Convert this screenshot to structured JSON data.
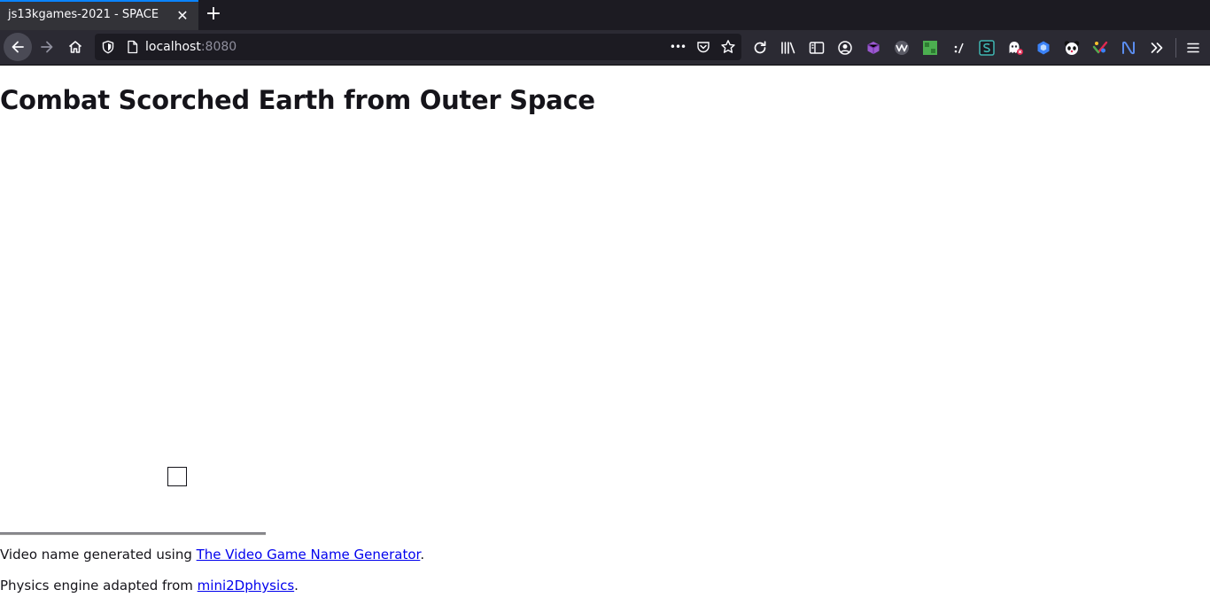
{
  "browser": {
    "tab_title": "js13kgames-2021 - SPACE",
    "tab_close_glyph": "✕",
    "new_tab_glyph": "+",
    "url_host": "localhost",
    "url_port": ":8080",
    "url_more_glyph": "•••",
    "toolbar_icons": [
      "reload-icon",
      "library-icon",
      "sidebar-icon",
      "account-icon",
      "extension-cube-icon",
      "extension-wave-icon",
      "extension-green-icon",
      "extension-slash-icon",
      "extension-s-icon",
      "extension-ghostery-icon",
      "extension-hex-icon",
      "extension-panda-icon",
      "extension-color-icon",
      "extension-n-icon",
      "overflow-chevron-icon",
      "menu-icon"
    ]
  },
  "page": {
    "heading": "Combat Scorched Earth from Outer Space",
    "credit1": {
      "prefix": "Video name generated using ",
      "link": "The Video Game Name Generator",
      "suffix": "."
    },
    "credit2": {
      "prefix": "Physics engine adapted from ",
      "link": "mini2Dphysics",
      "suffix": "."
    }
  },
  "colors": {
    "tab_accent": "#0a84ff",
    "chrome_dark": "#1c1b22",
    "chrome_toolbar": "#2b2a33",
    "link": "#0000ee"
  }
}
